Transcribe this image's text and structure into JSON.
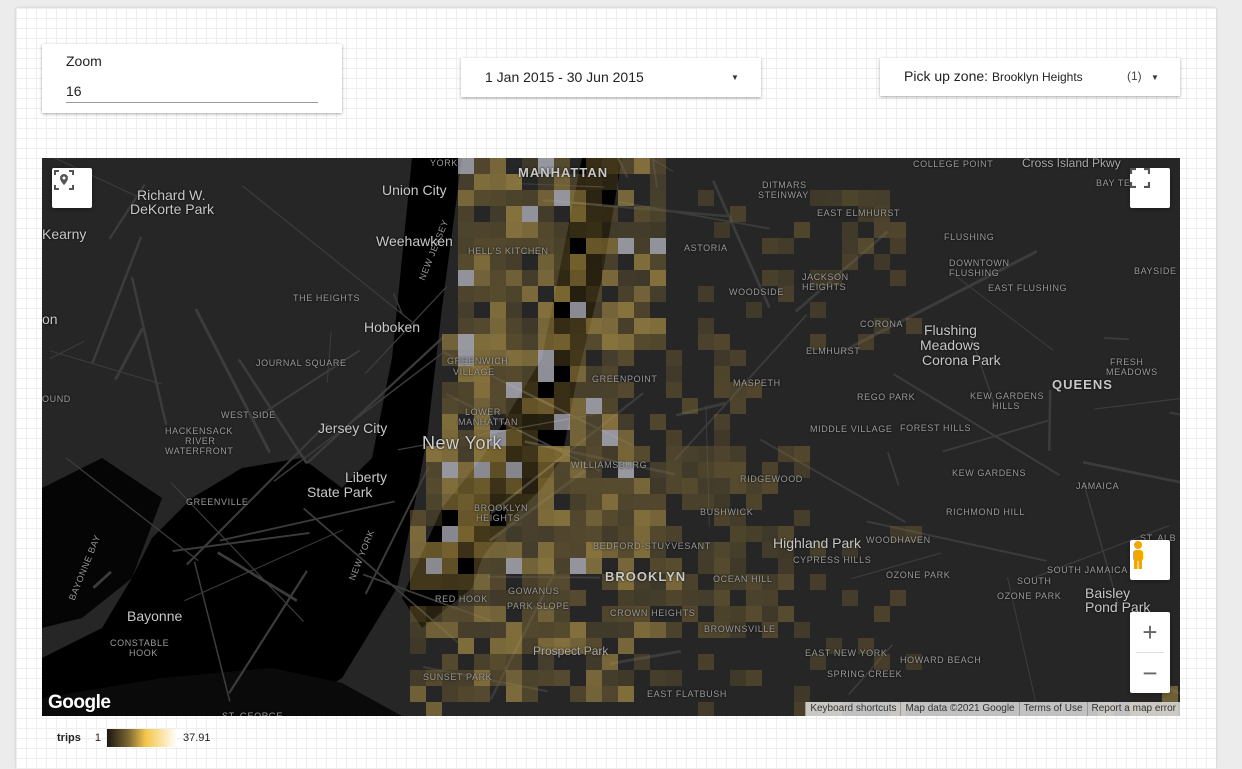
{
  "controls": {
    "zoom": {
      "label": "Zoom",
      "value": "16"
    },
    "date_range": {
      "value": "1 Jan 2015 - 30 Jun 2015"
    },
    "pickup_zone": {
      "label": "Pick up zone:",
      "value": "Brooklyn Heights",
      "count": "(1)"
    }
  },
  "map": {
    "labels": [
      "York",
      "Union City",
      "MANHATTAN",
      "Richard W.",
      "DeKorte Park",
      "Kearny",
      "Weehawken",
      "HELL'S KITCHEN",
      "THE HEIGHTS",
      "Hoboken",
      "JOURNAL SQUARE",
      "GREENWICH",
      "VILLAGE",
      "WEST SIDE",
      "HACKENSACK",
      "RIVER",
      "WATERFRONT",
      "LOWER",
      "MANHATTAN",
      "Jersey City",
      "New York",
      "Liberty",
      "State Park",
      "GREENVILLE",
      "BROOKLYN",
      "HEIGHTS",
      "Bayonne",
      "CONSTABLE",
      "HOOK",
      "GOWANUS",
      "RED HOOK",
      "PARK SLOPE",
      "Prospect Park",
      "SUNSET PARK",
      "ST. GEORGE",
      "COLLEGE POINT",
      "Cross Island Pkwy",
      "DITMARS",
      "STEINWAY",
      "EAST ELMHURST",
      "BAY TE",
      "ASTORIA",
      "FLUSHING",
      "DOWNTOWN",
      "FLUSHING",
      "BAYSIDE",
      "JACKSON",
      "HEIGHTS",
      "WOODSIDE",
      "EAST FLUSHING",
      "CORONA",
      "Flushing",
      "Meadows",
      "Corona Park",
      "ELMHURST",
      "GREENPOINT",
      "MASPETH",
      "FRESH",
      "MEADOWS",
      "QUEENS",
      "REGO PARK",
      "KEW GARDENS",
      "HILLS",
      "MIDDLE VILLAGE",
      "FOREST HILLS",
      "WILLIAMSBURG",
      "RIDGEWOOD",
      "KEW GARDENS",
      "JAMAICA",
      "BUSHWICK",
      "RICHMOND HILL",
      "BEDFORD-STUYVESANT",
      "Highland Park",
      "CYPRESS HILLS",
      "WOODHAVEN",
      "ST. ALB",
      "BROOKLYN",
      "OCEAN HILL",
      "OZONE PARK",
      "SOUTH JAMAICA",
      "SOUTH",
      "OZONE PARK",
      "Baisley",
      "Pond Park",
      "CROWN HEIGHTS",
      "BROWNSVILLE",
      "EAST NEW YORK",
      "HOWARD BEACH",
      "SPRING CREEK",
      "EAST FLATBUSH",
      "Bayonne Bay",
      "on",
      "OUND",
      "NEW JERSEY",
      "NEW YORK"
    ],
    "logo": "Google",
    "attribution": [
      "Keyboard shortcuts",
      "Map data ©2021 Google",
      "Terms of Use",
      "Report a map error"
    ],
    "icons": [
      "locate-icon",
      "fullscreen-icon",
      "pegman-icon",
      "zoom-in-icon",
      "zoom-out-icon"
    ],
    "zoom_in": "+",
    "zoom_out": "−"
  },
  "legend": {
    "metric": "trips",
    "min": "1",
    "max": "37.91",
    "colors": [
      "#1b1710",
      "#f3c54a",
      "#ffffff"
    ]
  }
}
